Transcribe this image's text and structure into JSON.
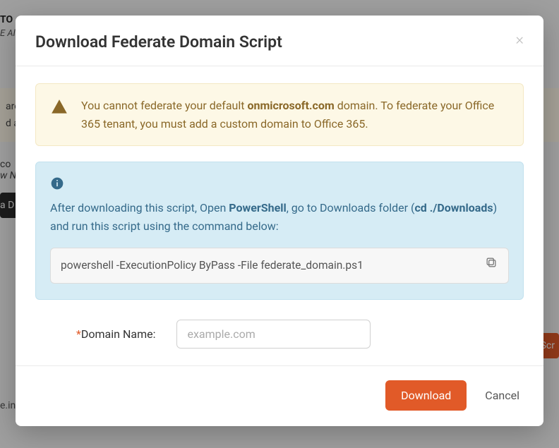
{
  "background": {
    "header": "TO",
    "sub": "E Al",
    "yellow_lines": [
      "are",
      "d a"
    ],
    "text_frag": "co",
    "ital_frag": "w N",
    "dark_btn": "a D",
    "orange_btn": "Scr",
    "bottom": "e.in"
  },
  "modal": {
    "title": "Download Federate Domain Script",
    "warning": {
      "pre": "You cannot federate your default ",
      "bold": "onmicrosoft.com",
      "post": " domain. To federate your Office 365 tenant, you must add a custom domain to Office 365."
    },
    "info": {
      "pre": "After downloading this script, Open ",
      "bold1": "PowerShell",
      "mid1": ", go to Downloads folder (",
      "bold2": "cd ./Downloads",
      "mid2": ") and run this script using the command below:"
    },
    "command": "powershell -ExecutionPolicy ByPass -File federate_domain.ps1",
    "form": {
      "required": "*",
      "label": "Domain Name:",
      "placeholder": "example.com"
    },
    "footer": {
      "download": "Download",
      "cancel": "Cancel"
    }
  }
}
